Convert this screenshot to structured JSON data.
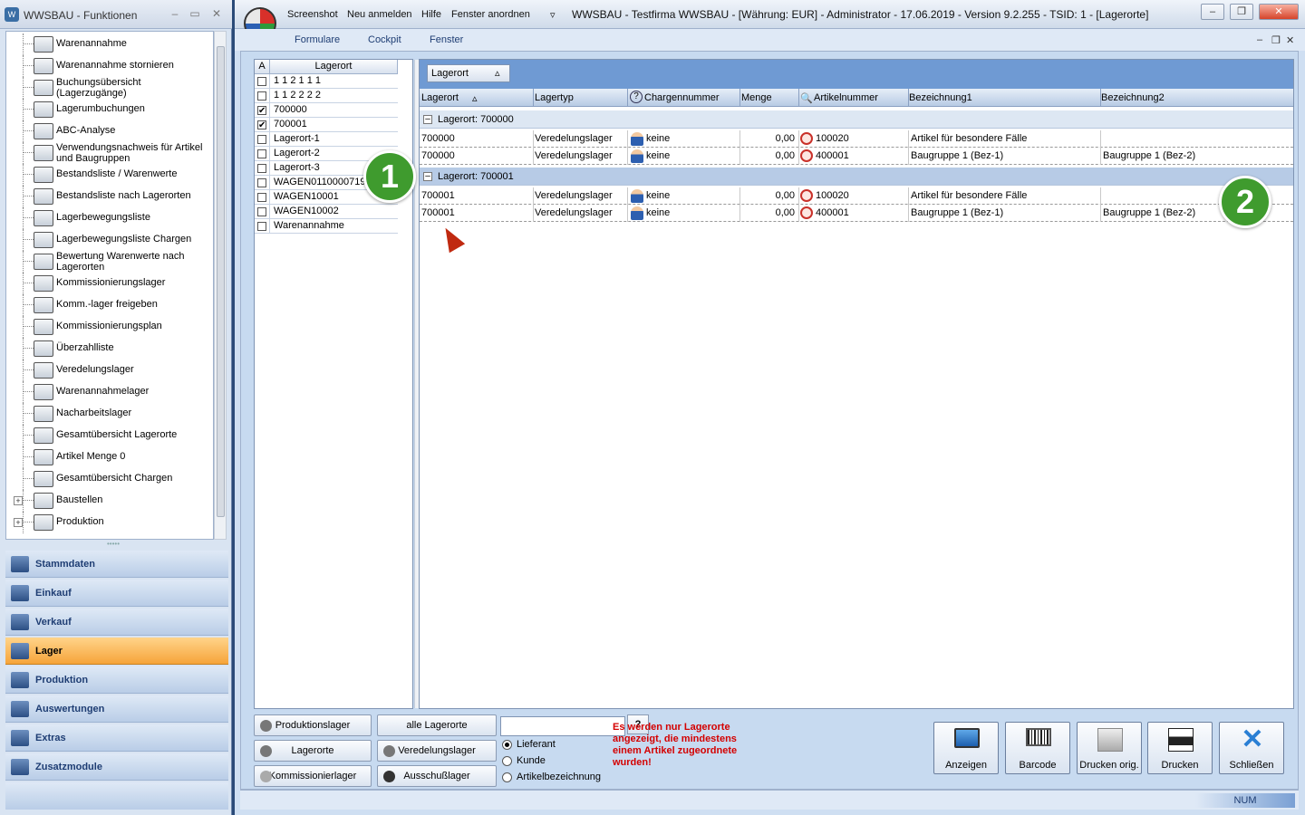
{
  "left_panel": {
    "title": "WWSBAU - Funktionen",
    "tree": [
      {
        "label": "Warenannahme",
        "icon": "warehouse-receive-icon"
      },
      {
        "label": "Warenannahme stornieren",
        "icon": "cancel-receive-icon"
      },
      {
        "label": "Buchungsübersicht (Lagerzugänge)",
        "icon": "booking-list-icon"
      },
      {
        "label": "Lagerumbuchungen",
        "icon": "transfer-icon"
      },
      {
        "label": "ABC-Analyse",
        "icon": "abc-icon"
      },
      {
        "label": "Verwendungsnachweis für Artikel und Baugruppen",
        "icon": "usage-icon"
      },
      {
        "label": "Bestandsliste / Warenwerte",
        "icon": "inventory-icon"
      },
      {
        "label": "Bestandsliste nach Lagerorten",
        "icon": "inventory-location-icon"
      },
      {
        "label": "Lagerbewegungsliste",
        "icon": "movement-icon"
      },
      {
        "label": "Lagerbewegungsliste Chargen",
        "icon": "movement-batch-icon"
      },
      {
        "label": "Bewertung Warenwerte nach Lagerorten",
        "icon": "valuation-icon"
      },
      {
        "label": "Kommissionierungslager",
        "icon": "picking-icon"
      },
      {
        "label": "Komm.-lager freigeben",
        "icon": "release-icon"
      },
      {
        "label": "Kommissionierungsplan",
        "icon": "plan-icon"
      },
      {
        "label": "Überzahlliste",
        "icon": "surplus-icon"
      },
      {
        "label": "Veredelungslager",
        "icon": "refine-icon"
      },
      {
        "label": "Warenannahmelager",
        "icon": "receive-store-icon"
      },
      {
        "label": "Nacharbeitslager",
        "icon": "rework-icon"
      },
      {
        "label": "Gesamtübersicht Lagerorte",
        "icon": "overview-icon"
      },
      {
        "label": "Artikel Menge 0",
        "icon": "warning-icon"
      },
      {
        "label": "Gesamtübersicht Chargen",
        "icon": "monitor-icon"
      },
      {
        "label": "Baustellen",
        "icon": "construction-icon"
      },
      {
        "label": "Produktion",
        "icon": "production-icon"
      }
    ],
    "categories": [
      "Stammdaten",
      "Einkauf",
      "Verkauf",
      "Lager",
      "Produktion",
      "Auswertungen",
      "Extras",
      "Zusatzmodule"
    ],
    "active_category": "Lager"
  },
  "titlebar": {
    "quick": [
      "Screenshot",
      "Neu anmelden",
      "Hilfe",
      "Fenster anordnen"
    ],
    "title": "WWSBAU - Testfirma WWSBAU - [Währung: EUR] - Administrator - 17.06.2019 - Version 9.2.255 - TSID: 1 - [Lagerorte]"
  },
  "menu": [
    "Formulare",
    "Cockpit",
    "Fenster"
  ],
  "location_list": {
    "headers": [
      "A",
      "Lagerort"
    ],
    "items": [
      {
        "label": "1  1  2  1  1  1",
        "checked": false
      },
      {
        "label": "1  1  2  2  2  2",
        "checked": false
      },
      {
        "label": "700000",
        "checked": true
      },
      {
        "label": "700001",
        "checked": true
      },
      {
        "label": "Lagerort-1",
        "checked": false
      },
      {
        "label": "Lagerort-2",
        "checked": false
      },
      {
        "label": "Lagerort-3",
        "checked": false
      },
      {
        "label": "WAGEN0110000719",
        "checked": false
      },
      {
        "label": "WAGEN10001",
        "checked": false
      },
      {
        "label": "WAGEN10002",
        "checked": false
      },
      {
        "label": "Warenannahme",
        "checked": false
      }
    ]
  },
  "grid": {
    "group_chip": "Lagerort",
    "columns": [
      "Lagerort",
      "Lagertyp",
      "Chargennummer",
      "Menge",
      "Artikelnummer",
      "Bezeichnung1",
      "Bezeichnung2"
    ],
    "groups": [
      {
        "label": "Lagerort: 700000",
        "rows": [
          {
            "lagerort": "700000",
            "lagertyp": "Veredelungslager",
            "charge": "keine",
            "menge": "0,00",
            "artikel": "100020",
            "bez1": "Artikel für besondere Fälle",
            "bez2": ""
          },
          {
            "lagerort": "700000",
            "lagertyp": "Veredelungslager",
            "charge": "keine",
            "menge": "0,00",
            "artikel": "400001",
            "bez1": "Baugruppe 1  (Bez-1)",
            "bez2": "Baugruppe 1  (Bez-2)"
          }
        ]
      },
      {
        "label": "Lagerort: 700001",
        "rows": [
          {
            "lagerort": "700001",
            "lagertyp": "Veredelungslager",
            "charge": "keine",
            "menge": "0,00",
            "artikel": "100020",
            "bez1": "Artikel für besondere Fälle",
            "bez2": ""
          },
          {
            "lagerort": "700001",
            "lagertyp": "Veredelungslager",
            "charge": "keine",
            "menge": "0,00",
            "artikel": "400001",
            "bez1": "Baugruppe 1  (Bez-1)",
            "bez2": "Baugruppe 1  (Bez-2)"
          }
        ]
      }
    ]
  },
  "bottom": {
    "buttons_col1": [
      "Produktionslager",
      "Lagerorte",
      "Kommissionierlager"
    ],
    "buttons_col2": [
      "alle Lagerorte",
      "Veredelungslager",
      "Ausschußlager"
    ],
    "search_value": "",
    "help_label": "?",
    "radios": [
      {
        "label": "Lieferant",
        "selected": true
      },
      {
        "label": "Kunde",
        "selected": false
      },
      {
        "label": "Artikelbezeichnung",
        "selected": false
      }
    ],
    "warning": "Es werden nur Lagerorte angezeigt, die mindestens einem Artikel zugeordnete wurden!",
    "actions": [
      "Anzeigen",
      "Barcode",
      "Drucken orig.",
      "Drucken",
      "Schließen"
    ]
  },
  "status": {
    "num": "NUM"
  },
  "badges": [
    "1",
    "2"
  ],
  "colors": {
    "accent": "#f6a43a",
    "badge": "#3f9b2e",
    "warning": "#d40000",
    "close": "#2a7fd4"
  }
}
